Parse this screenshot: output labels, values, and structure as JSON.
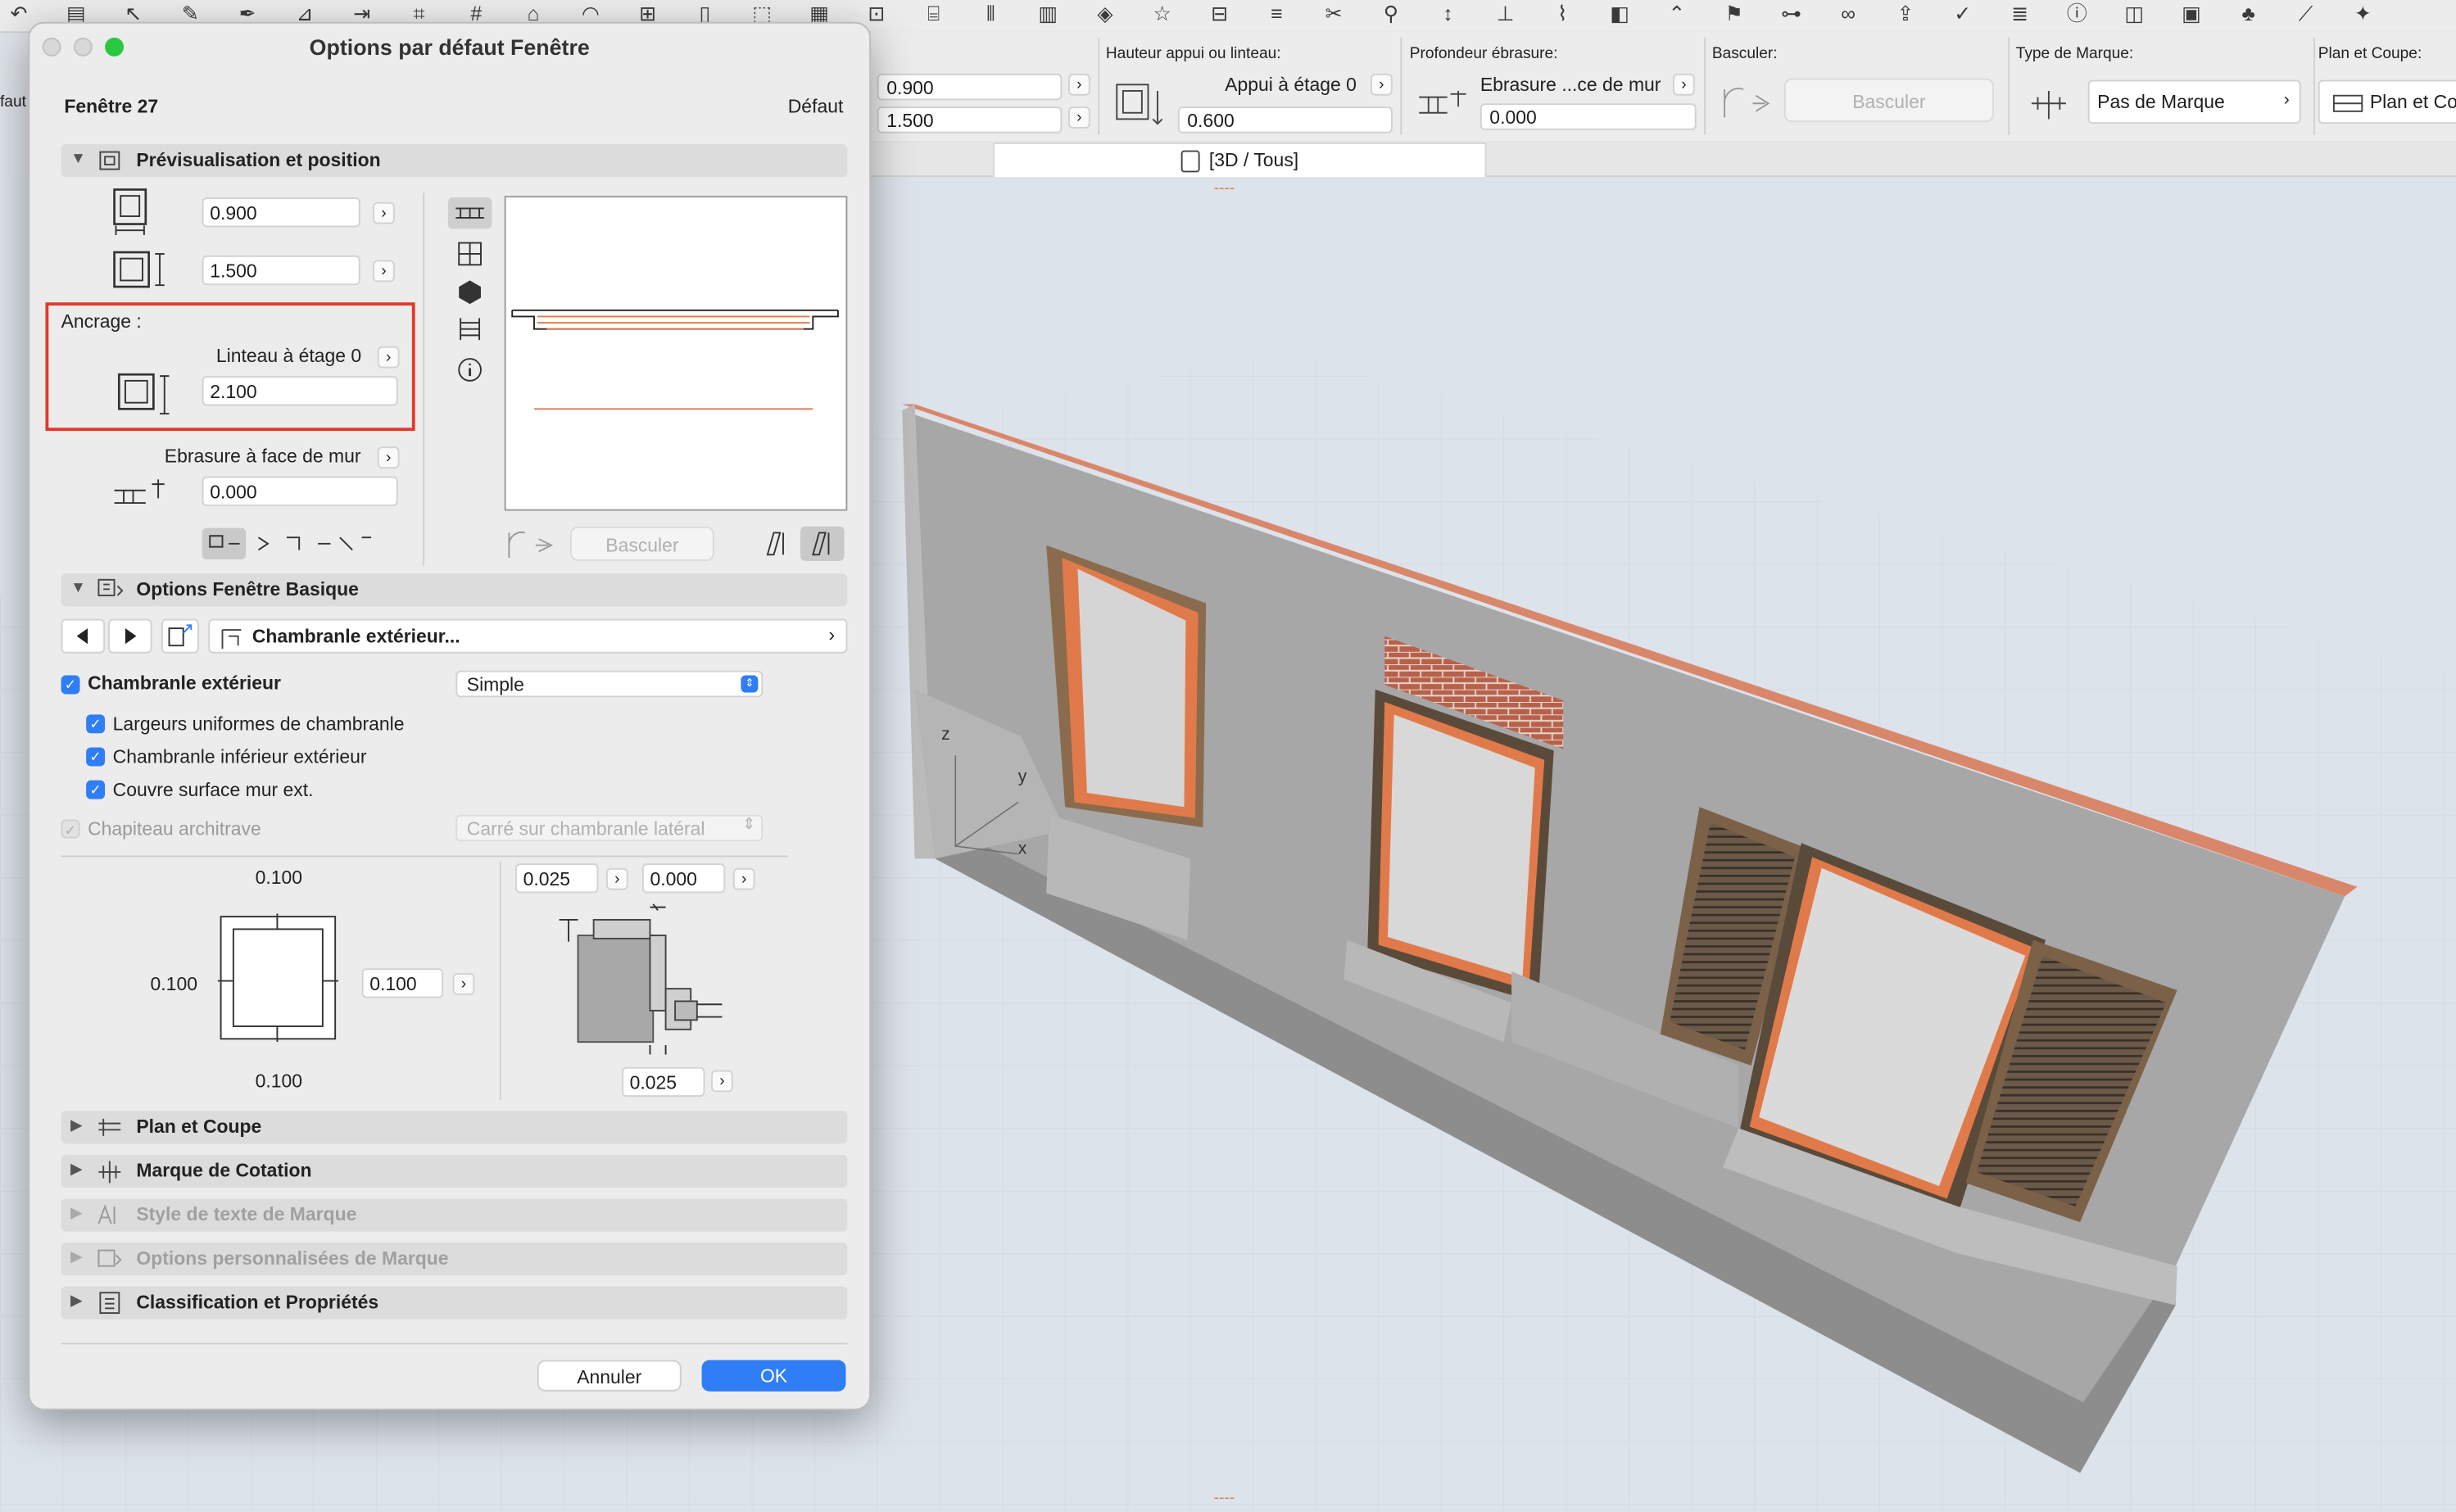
{
  "toolbar": {
    "icons": [
      "undo-icon",
      "wall-icon",
      "arrow-icon",
      "pencil-icon",
      "pen-icon",
      "dimension-icon",
      "level-icon",
      "xy-icon",
      "grid-icon",
      "roof-icon",
      "shell-icon",
      "window-icon",
      "door-icon",
      "object-icon",
      "mesh-icon",
      "label-icon",
      "stair-icon",
      "railing-icon",
      "curtain-icon",
      "morph-icon",
      "star-icon",
      "section-icon",
      "elevation-icon",
      "split-icon",
      "magic-wand-icon",
      "adjust-icon",
      "trim-icon",
      "brush-icon",
      "fill-icon",
      "roof-tool-icon",
      "flag-icon",
      "sitemap-icon",
      "link-icon",
      "export-icon",
      "check-icon",
      "layers-icon",
      "info-icon",
      "map-icon",
      "id-icon",
      "tree-icon",
      "ruler-icon",
      "favorite-icon"
    ]
  },
  "infobox": {
    "left_partial_label": "faut",
    "width_value": "0.900",
    "height_value": "1.500",
    "sill_label": "Hauteur appui ou linteau:",
    "sill_mode": "Appui à étage 0",
    "sill_value": "0.600",
    "reveal_label": "Profondeur ébrasure:",
    "reveal_mode": "Ebrasure ...ce de mur",
    "reveal_value": "0.000",
    "flip_label": "Basculer:",
    "flip_button": "Basculer",
    "marker_label": "Type de Marque:",
    "marker_value": "Pas de Marque",
    "plan_label": "Plan et Coupe:",
    "plan_value": "Plan et Co"
  },
  "tabbar": {
    "view_tab": "[3D / Tous]"
  },
  "dialog": {
    "title": "Options par défaut Fenêtre",
    "element_name": "Fenêtre 27",
    "default_label": "Défaut",
    "preview_section": "Prévisualisation et position",
    "width": "0.900",
    "height": "1.500",
    "anchor_label": "Ancrage :",
    "anchor_mode": "Linteau à étage 0",
    "anchor_value": "2.100",
    "reveal_mode": "Ebrasure à face de mur",
    "reveal_value": "0.000",
    "flip_button": "Basculer",
    "basic_section": "Options Fenêtre Basique",
    "nav_item": "Chambranle extérieur...",
    "frame_checkbox": "Chambranle extérieur",
    "frame_style": "Simple",
    "uniform_widths": "Largeurs uniformes de chambranle",
    "lower_frame": "Chambranle inférieur extérieur",
    "cover_wall": "Couvre surface mur ext.",
    "capital": "Chapiteau architrave",
    "capital_style": "Carré sur chambranle latéral",
    "dim_top": "0.100",
    "dim_left": "0.100",
    "dim_right": "0.100",
    "dim_bottom": "0.100",
    "profile_a": "0.025",
    "profile_b": "0.000",
    "profile_c": "0.025",
    "sections": [
      "Plan et Coupe",
      "Marque de Cotation",
      "Style de texte de Marque",
      "Options personnalisées de Marque",
      "Classification et Propriétés"
    ],
    "cancel_button": "Annuler",
    "ok_button": "OK"
  },
  "viewport": {
    "axis_x": "x",
    "axis_y": "y",
    "axis_z": "z",
    "dashes_top": "----",
    "dashes_bottom": "----"
  },
  "colors": {
    "accent": "#2f7ef6",
    "highlight_box": "#e03a2a",
    "wall": "#9c9c9c",
    "frame_orange": "#e07a4a"
  }
}
